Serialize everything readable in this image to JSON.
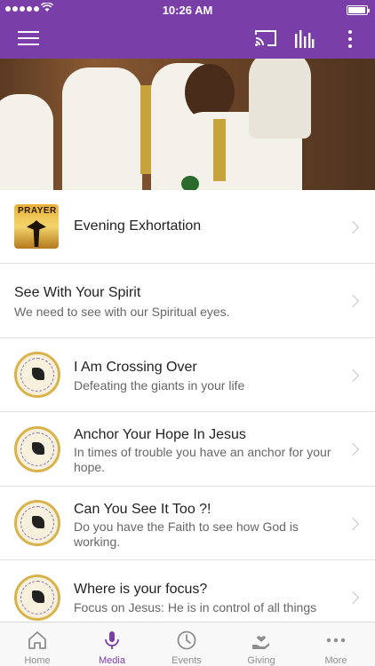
{
  "status_bar": {
    "time": "10:26 AM"
  },
  "app_bar": {
    "menu_icon": "hamburger-icon",
    "cast_icon": "cast-icon",
    "audio_icon": "equalizer-icon",
    "more_icon": "kebab-icon",
    "accent_color": "#7a3ea8"
  },
  "media_list": [
    {
      "title": "Evening Exhortation",
      "subtitle": "",
      "thumbnail": "prayer",
      "thumbnail_text": "PRAYER"
    },
    {
      "title": "See With Your Spirit",
      "subtitle": "We need to see with our Spiritual eyes.",
      "thumbnail": "none"
    },
    {
      "title": "I Am Crossing Over",
      "subtitle": "Defeating the giants in your life",
      "thumbnail": "church-seal"
    },
    {
      "title": "Anchor Your Hope In Jesus",
      "subtitle": "In times of trouble you have an anchor for your hope.",
      "thumbnail": "church-seal"
    },
    {
      "title": "Can You See It Too ?!",
      "subtitle": "Do you have the Faith to see how God is working.",
      "thumbnail": "church-seal"
    },
    {
      "title": "Where is your focus?",
      "subtitle": "Focus on Jesus: He is in control of all things",
      "thumbnail": "church-seal"
    }
  ],
  "tab_bar": {
    "active": "Media",
    "tabs": [
      {
        "label": "Home",
        "icon": "home-icon"
      },
      {
        "label": "Media",
        "icon": "microphone-icon"
      },
      {
        "label": "Events",
        "icon": "clock-icon"
      },
      {
        "label": "Giving",
        "icon": "giving-hand-icon"
      },
      {
        "label": "More",
        "icon": "more-dots-icon"
      }
    ]
  }
}
